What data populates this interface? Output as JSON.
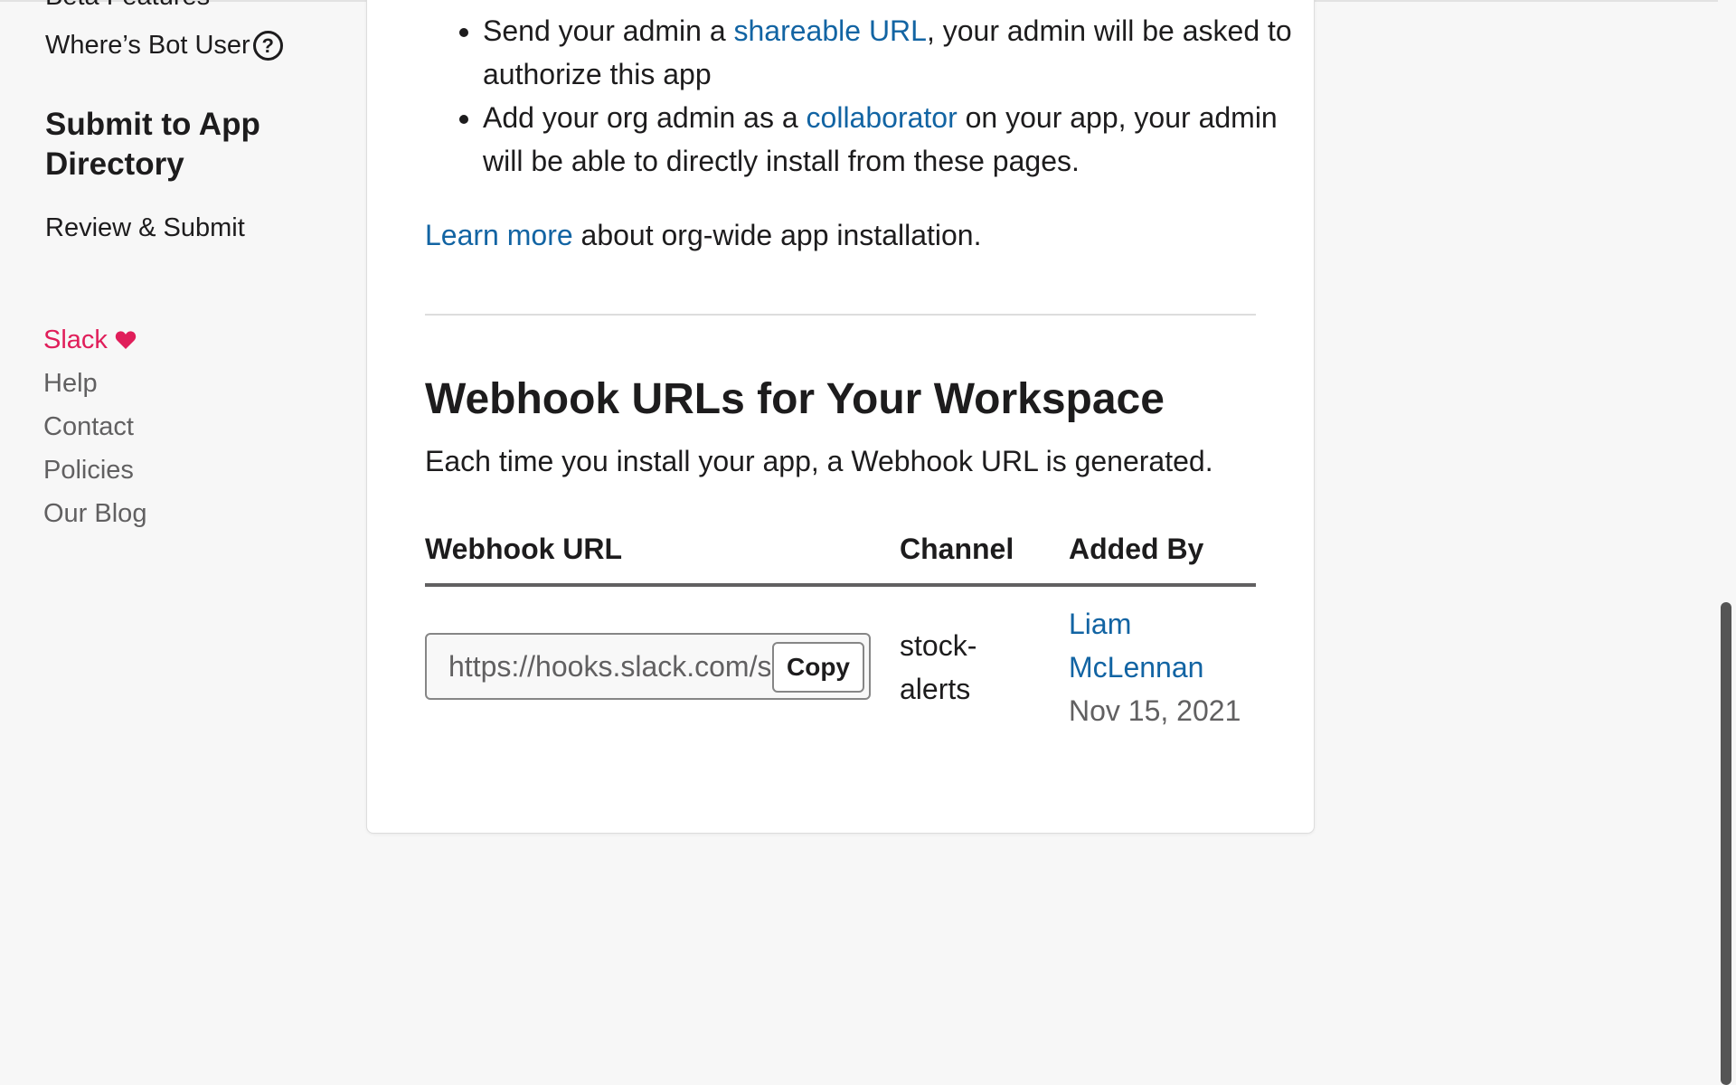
{
  "sidebar": {
    "cut_item": "Beta Features",
    "bot_user": "Where’s Bot User",
    "help_icon": "question-circle-icon",
    "section_title": "Submit to App Directory",
    "review_submit": "Review & Submit",
    "footer": {
      "slack": "Slack",
      "help": "Help",
      "contact": "Contact",
      "policies": "Policies",
      "blog": "Our Blog"
    }
  },
  "content": {
    "bullet1": {
      "pre": "Send your admin a ",
      "link": "shareable URL",
      "post": ", your admin will be asked to authorize this app"
    },
    "bullet2": {
      "pre": "Add your org admin as a ",
      "link": "collaborator",
      "post": " on your app, your admin will be able to directly install from these pages."
    },
    "learn_more": {
      "link": "Learn more",
      "post": " about org-wide app installation."
    },
    "heading": "Webhook URLs for Your Workspace",
    "description": "Each time you install your app, a Webhook URL is generated.",
    "table": {
      "columns": [
        "Webhook URL",
        "Channel",
        "Added By"
      ],
      "rows": [
        {
          "url": "https://hooks.slack.com/s",
          "copy_label": "Copy",
          "channel": "stock-alerts",
          "added_by": "Liam McLennan",
          "date": "Nov 15, 2021"
        }
      ]
    }
  },
  "colors": {
    "link": "#1264a3",
    "slack_accent": "#e01e5a",
    "muted": "#616061"
  }
}
